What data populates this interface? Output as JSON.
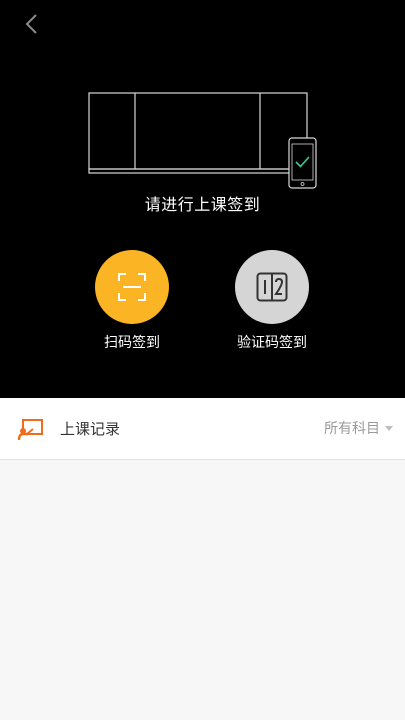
{
  "header": {
    "back_icon": "chevron-left-icon"
  },
  "checkin": {
    "prompt": "请进行上课签到",
    "scan": {
      "label": "扫码签到",
      "icon": "scan-frame-icon",
      "color": "#fbb424"
    },
    "code": {
      "label": "验证码签到",
      "icon": "verify-code-icon",
      "color": "#d5d5d5"
    }
  },
  "records": {
    "title": "上课记录",
    "icon": "classroom-board-icon",
    "icon_color": "#f26b1d",
    "filter_label": "所有科目"
  }
}
